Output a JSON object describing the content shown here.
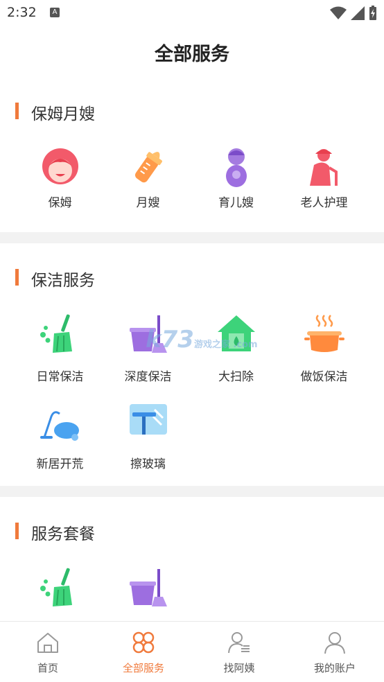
{
  "status": {
    "time": "2:32",
    "notif_letter": "A"
  },
  "page": {
    "title": "全部服务"
  },
  "sections": [
    {
      "title": "保姆月嫂",
      "items": [
        {
          "label": "保姆",
          "icon": "nanny-face-icon"
        },
        {
          "label": "月嫂",
          "icon": "baby-bottle-icon"
        },
        {
          "label": "育儿嫂",
          "icon": "childcare-person-icon"
        },
        {
          "label": "老人护理",
          "icon": "elder-with-cane-icon"
        }
      ]
    },
    {
      "title": "保洁服务",
      "items": [
        {
          "label": "日常保洁",
          "icon": "broom-icon"
        },
        {
          "label": "深度保洁",
          "icon": "bucket-mop-icon"
        },
        {
          "label": "大扫除",
          "icon": "house-icon"
        },
        {
          "label": "做饭保洁",
          "icon": "cooking-pot-icon"
        },
        {
          "label": "新居开荒",
          "icon": "vacuum-icon"
        },
        {
          "label": "擦玻璃",
          "icon": "window-squeegee-icon"
        }
      ]
    },
    {
      "title": "服务套餐",
      "items": [
        {
          "label": "",
          "icon": "broom-icon"
        },
        {
          "label": "",
          "icon": "bucket-mop-icon"
        }
      ]
    }
  ],
  "watermark": {
    "text": "k73",
    "sub": "游戏之家 .com"
  },
  "tabs": [
    {
      "label": "首页",
      "icon": "home-icon",
      "active": false
    },
    {
      "label": "全部服务",
      "icon": "grid-clover-icon",
      "active": true
    },
    {
      "label": "找阿姨",
      "icon": "person-list-icon",
      "active": false
    },
    {
      "label": "我的账户",
      "icon": "user-icon",
      "active": false
    }
  ],
  "colors": {
    "accent": "#f07a3c",
    "divider": "#f2f2f2"
  }
}
